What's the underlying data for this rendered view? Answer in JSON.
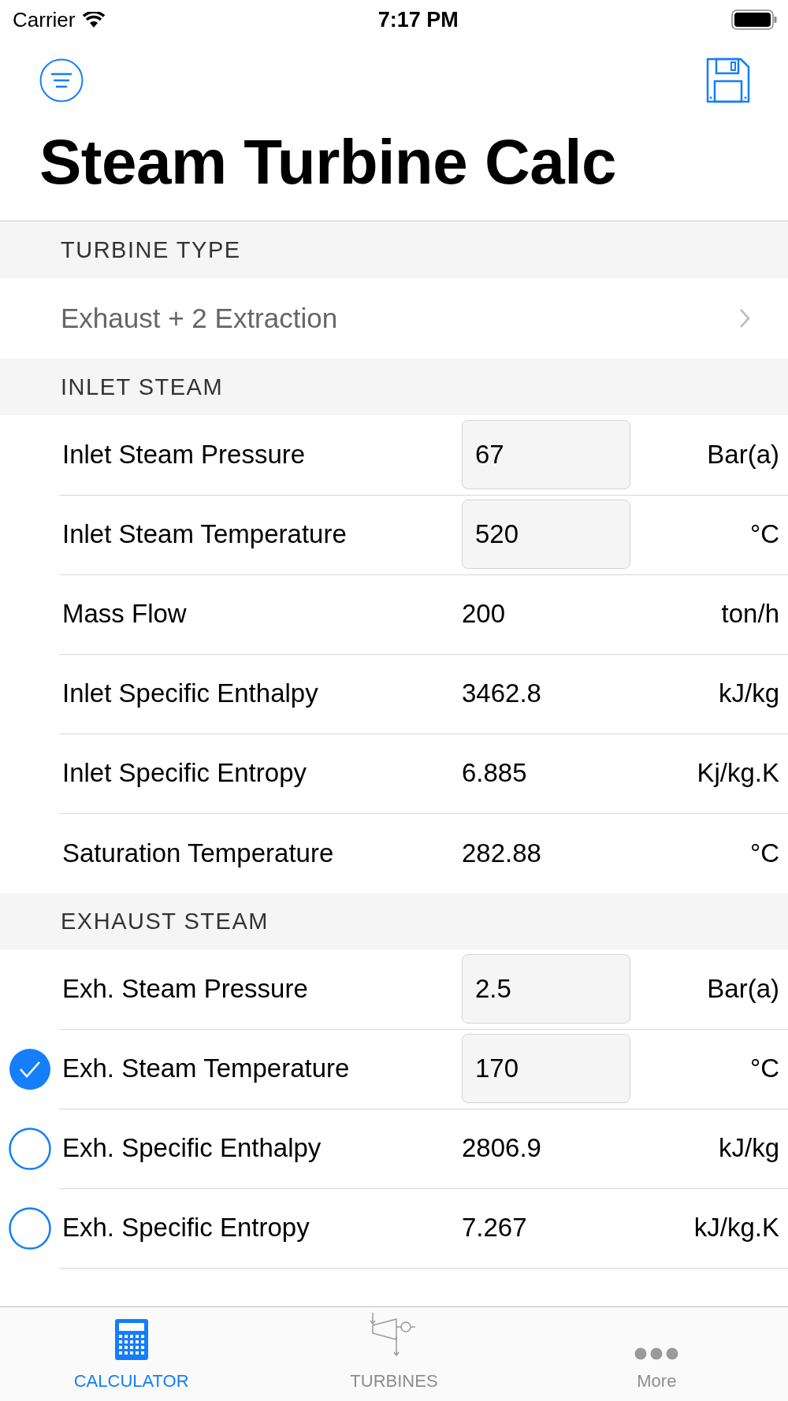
{
  "status_bar": {
    "carrier": "Carrier",
    "time": "7:17 PM"
  },
  "title": "Steam Turbine Calc",
  "turbine_type": {
    "header": "TURBINE TYPE",
    "value": "Exhaust + 2 Extraction"
  },
  "inlet": {
    "header": "INLET STEAM",
    "rows": [
      {
        "label": "Inlet Steam Pressure",
        "kind": "input",
        "value": "67",
        "unit": "Bar(a)"
      },
      {
        "label": "Inlet Steam Temperature",
        "kind": "input",
        "value": "520",
        "unit": "°C"
      },
      {
        "label": "Mass Flow",
        "kind": "value",
        "value": "200",
        "unit": "ton/h"
      },
      {
        "label": "Inlet Specific Enthalpy",
        "kind": "value",
        "value": "3462.8",
        "unit": "kJ/kg"
      },
      {
        "label": "Inlet Specific Entropy",
        "kind": "value",
        "value": "6.885",
        "unit": "Kj/kg.K"
      },
      {
        "label": "Saturation Temperature",
        "kind": "value",
        "value": "282.88",
        "unit": "°C"
      }
    ]
  },
  "exhaust": {
    "header": "EXHAUST STEAM",
    "rows": [
      {
        "label": "Exh. Steam Pressure",
        "kind": "input",
        "value": "2.5",
        "unit": "Bar(a)"
      },
      {
        "label": "Exh. Steam Temperature",
        "kind": "input",
        "value": "170",
        "unit": "°C",
        "selected": true
      },
      {
        "label": "Exh. Specific Enthalpy",
        "kind": "value",
        "value": "2806.9",
        "unit": "kJ/kg",
        "selected": false
      },
      {
        "label": "Exh. Specific Entropy",
        "kind": "value",
        "value": "7.267",
        "unit": "kJ/kg.K",
        "selected": false
      }
    ]
  },
  "tab_bar": [
    {
      "label": "CALCULATOR",
      "selected": true
    },
    {
      "label": "TURBINES",
      "selected": false
    },
    {
      "label": "More",
      "selected": false
    }
  ]
}
